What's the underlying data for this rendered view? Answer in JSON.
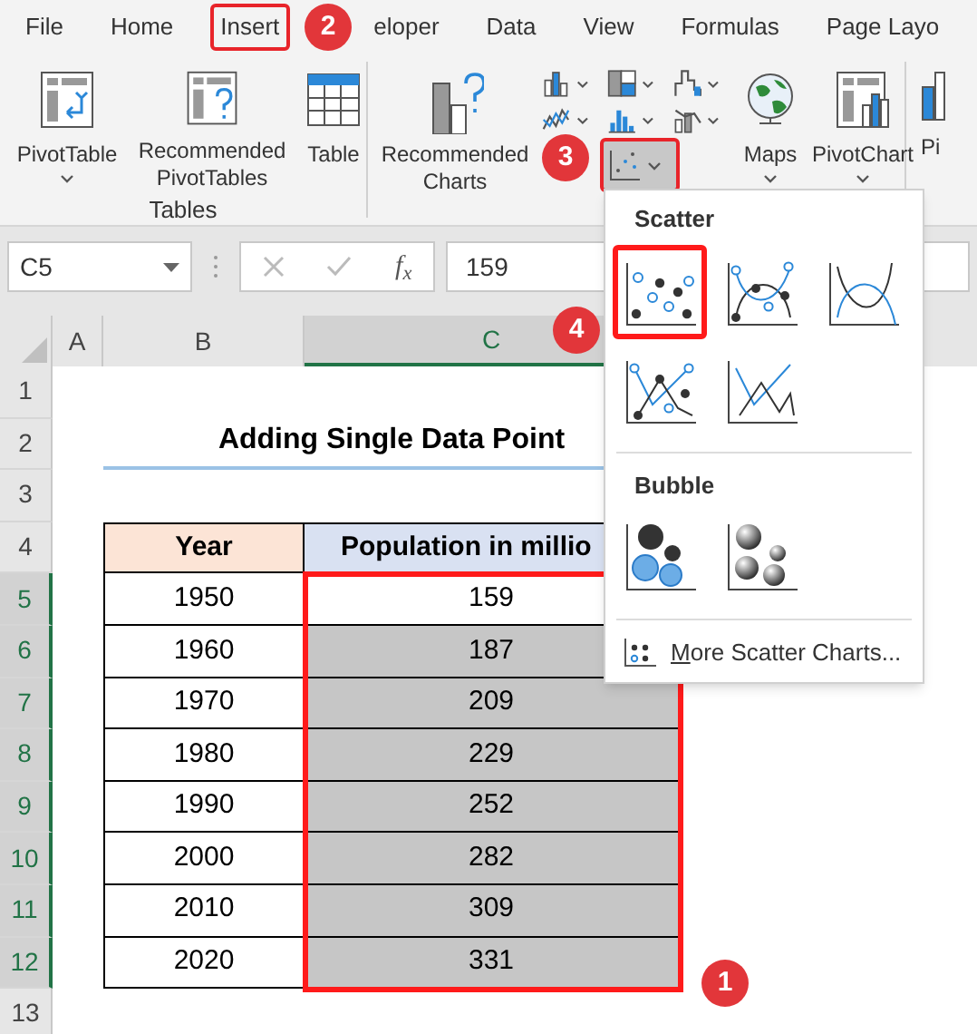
{
  "tabs": [
    {
      "label": "File",
      "highlighted": false
    },
    {
      "label": "Home",
      "highlighted": false
    },
    {
      "label": "Insert",
      "highlighted": true,
      "badge": "2"
    },
    {
      "label": "eloper",
      "highlighted": false
    },
    {
      "label": "Data",
      "highlighted": false
    },
    {
      "label": "View",
      "highlighted": false
    },
    {
      "label": "Formulas",
      "highlighted": false
    },
    {
      "label": "Page Layo",
      "highlighted": false
    }
  ],
  "ribbon": {
    "tables_group": {
      "label": "Tables",
      "buttons": [
        {
          "label": "PivotTable",
          "dropdown": true
        },
        {
          "label": "Recommended PivotTables",
          "dropdown": false
        },
        {
          "label": "Table",
          "dropdown": false
        }
      ]
    },
    "charts_group": {
      "recommended": {
        "label": "Recommended Charts"
      },
      "chart_buttons": [
        {
          "highlighted": false
        },
        {
          "highlighted": false
        },
        {
          "highlighted": false
        },
        {
          "highlighted": false
        },
        {
          "highlighted": false
        },
        {
          "highlighted": false
        },
        {
          "highlighted": true,
          "badge": "3"
        }
      ],
      "buttons": [
        {
          "label": "Maps",
          "dropdown": true
        },
        {
          "label": "PivotChart",
          "dropdown": true
        },
        {
          "label": "Pi",
          "dropdown": false
        }
      ]
    }
  },
  "formula_bar": {
    "name_box": "C5",
    "function_label": "f$_{x}$",
    "value": "159"
  },
  "sheet": {
    "columns": [
      {
        "label": "A",
        "selected": false
      },
      {
        "label": "B",
        "selected": false
      },
      {
        "label": "C",
        "selected": true
      }
    ],
    "rows": [
      {
        "label": "1",
        "selected": false
      },
      {
        "label": "2",
        "selected": false
      },
      {
        "label": "3",
        "selected": false
      },
      {
        "label": "4",
        "selected": false
      },
      {
        "label": "5",
        "selected": true
      },
      {
        "label": "6",
        "selected": true
      },
      {
        "label": "7",
        "selected": true
      },
      {
        "label": "8",
        "selected": true
      },
      {
        "label": "9",
        "selected": true
      },
      {
        "label": "10",
        "selected": true
      },
      {
        "label": "11",
        "selected": true
      },
      {
        "label": "12",
        "selected": true
      },
      {
        "label": "13",
        "selected": false
      }
    ],
    "title": "Adding Single Data Point",
    "table": {
      "headers": [
        "Year",
        "Population in millio"
      ],
      "highlighted": true,
      "badge": "1",
      "rows": [
        {
          "year": "1950",
          "population": "159",
          "selected": false
        },
        {
          "year": "1960",
          "population": "187",
          "selected": true
        },
        {
          "year": "1970",
          "population": "209",
          "selected": true
        },
        {
          "year": "1980",
          "population": "229",
          "selected": true
        },
        {
          "year": "1990",
          "population": "252",
          "selected": true
        },
        {
          "year": "2000",
          "population": "282",
          "selected": true
        },
        {
          "year": "2010",
          "population": "309",
          "selected": true
        },
        {
          "year": "2020",
          "population": "331",
          "selected": true
        }
      ]
    }
  },
  "dropdown": {
    "sections": [
      {
        "title": "Scatter",
        "items": [
          {
            "kind": "scatter",
            "highlighted": true,
            "badge": "4"
          },
          {
            "kind": "smooth-markers",
            "highlighted": false
          },
          {
            "kind": "smooth",
            "highlighted": false
          },
          {
            "kind": "straight-markers",
            "highlighted": false
          },
          {
            "kind": "straight",
            "highlighted": false
          }
        ]
      },
      {
        "title": "Bubble",
        "items": [
          {
            "kind": "bubble",
            "highlighted": false
          },
          {
            "kind": "bubble-3d",
            "highlighted": false
          }
        ]
      }
    ],
    "more": "More Scatter Charts..."
  }
}
